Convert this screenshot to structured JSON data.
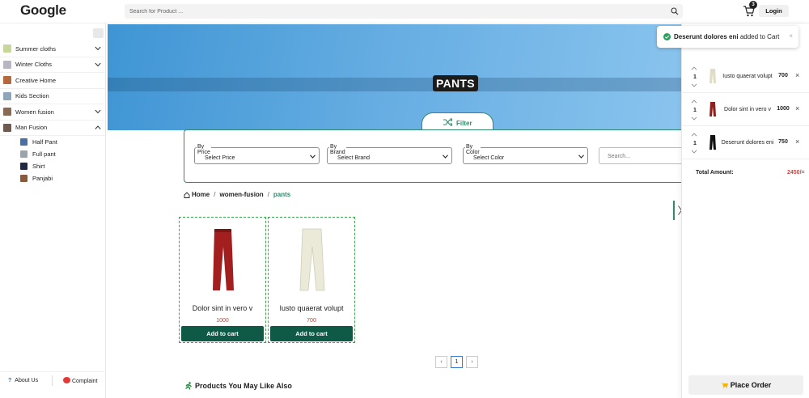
{
  "header": {
    "logo": "Google",
    "search_placeholder": "Search for Product ...",
    "cart_count": "3",
    "login_label": "Login"
  },
  "sidebar": {
    "items": [
      {
        "label": "Summer cloths",
        "thumb_color": "#c7d79a",
        "chevron": "down"
      },
      {
        "label": "Winter Cloths",
        "thumb_color": "#b9b6c4",
        "chevron": "down"
      },
      {
        "label": "Creative Home",
        "thumb_color": "#b46a3c",
        "chevron": ""
      },
      {
        "label": "Kids Section",
        "thumb_color": "#8fa6b8",
        "chevron": ""
      },
      {
        "label": "Women fusion",
        "thumb_color": "#8a6a52",
        "chevron": "down"
      },
      {
        "label": "Man Fusion",
        "thumb_color": "#6e5b4e",
        "chevron": "up"
      }
    ],
    "subitems": [
      {
        "label": "Half Pant",
        "thumb_color": "#4a6fa5"
      },
      {
        "label": "Full pant",
        "thumb_color": "#9ba3ad"
      },
      {
        "label": "Shirt",
        "thumb_color": "#1f2a44"
      },
      {
        "label": "Panjabi",
        "thumb_color": "#8a5a3a"
      }
    ],
    "about_label": "About Us",
    "complaint_label": "Complaint"
  },
  "banner": {
    "title": "PANTS",
    "filter_label": "Filter"
  },
  "filters": {
    "price_label": "By Price",
    "price_value": "Select Price",
    "brand_label": "By Brand",
    "brand_value": "Select Brand",
    "color_label": "By Color",
    "color_value": "Select Color",
    "search_placeholder": "Search..."
  },
  "breadcrumb": {
    "home": "Home",
    "parent": "women-fusion",
    "current": "pants",
    "separator": "/"
  },
  "products": [
    {
      "name": "Dolor sint in vero v",
      "price": "1000",
      "button": "Add to cart",
      "color": "#a31f1f"
    },
    {
      "name": "Iusto quaerat volupt",
      "price": "700",
      "button": "Add to cart",
      "color": "#e8e6d4"
    }
  ],
  "pagination": {
    "prev": "‹",
    "current": "1",
    "next": "›"
  },
  "also_heading": "Products You May Like Also",
  "toast": {
    "product": "Deserunt dolores eni",
    "message": "added to Cart",
    "close": "×"
  },
  "cart": {
    "items": [
      {
        "qty": "1",
        "name": "Iusto quaerat volupt",
        "price": "700",
        "color": "#e0dcc6"
      },
      {
        "qty": "1",
        "name": "Dolor sint in vero v",
        "price": "1000",
        "color": "#8f2020"
      },
      {
        "qty": "1",
        "name": "Deserunt dolores eni",
        "price": "750",
        "color": "#111111"
      }
    ],
    "remove": "×",
    "total_label": "Total Amount:",
    "total_value": "2450/=",
    "place_order": "Place Order"
  },
  "colors": {
    "accent": "#2e8b6b",
    "button": "#0f5a47",
    "price": "#d9342b",
    "banner": "#5aa8e0"
  }
}
